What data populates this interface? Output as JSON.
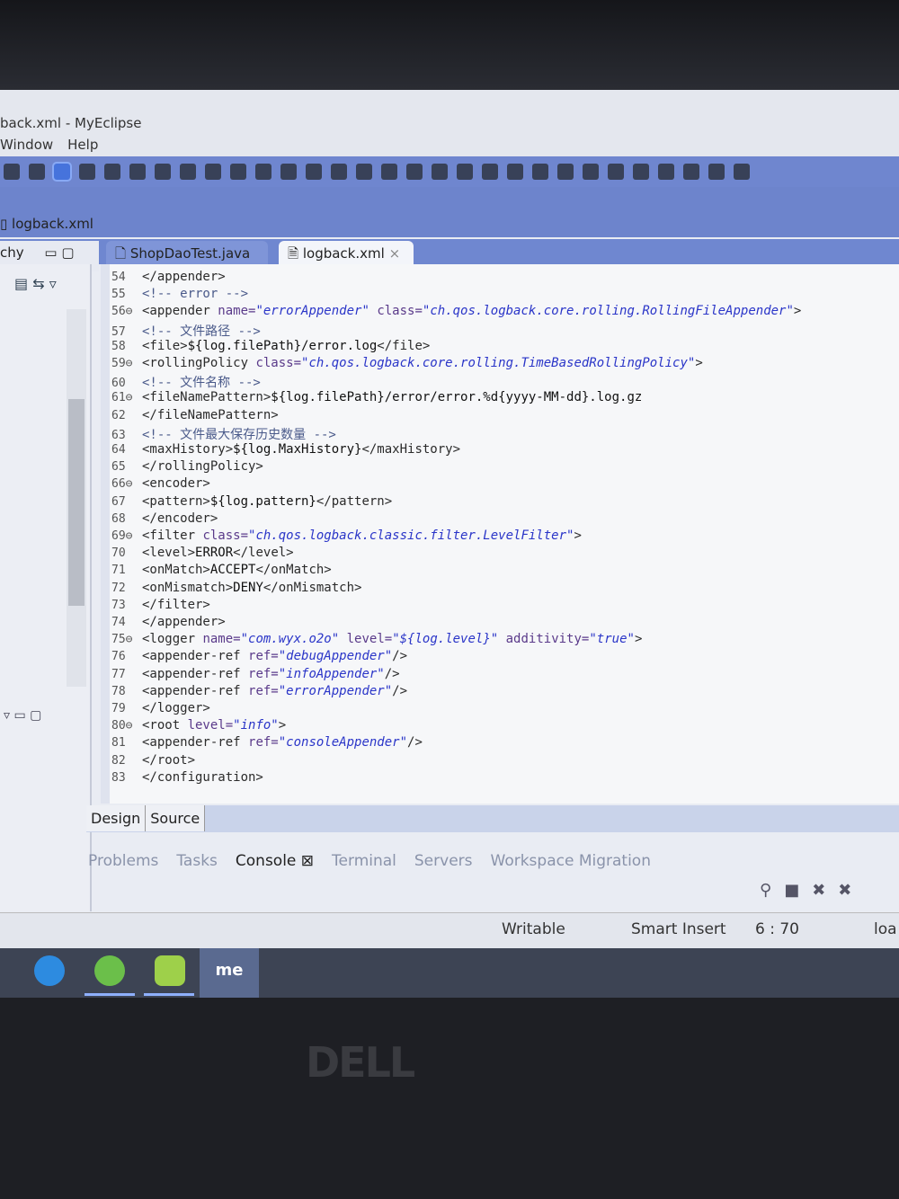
{
  "window": {
    "title": "back.xml - MyEclipse",
    "menu": [
      "Window",
      "Help"
    ]
  },
  "breadcrumb": "logback.xml",
  "left_panel": {
    "title": "chy"
  },
  "editor_tabs": [
    {
      "label": "ShopDaoTest.java",
      "active": false
    },
    {
      "label": "logback.xml",
      "active": true,
      "close": "×"
    }
  ],
  "code": [
    {
      "n": "54",
      "s": [
        [
          "tag",
          "</appender>"
        ]
      ]
    },
    {
      "n": "55",
      "s": [
        [
          "com",
          "<!-- error -->"
        ]
      ]
    },
    {
      "n": "56⊖",
      "s": [
        [
          "tag",
          "<appender "
        ],
        [
          "attr",
          "name="
        ],
        [
          "str",
          "\"errorAppender\""
        ],
        [
          "attr",
          " class="
        ],
        [
          "str",
          "\"ch.qos.logback.core.rolling.RollingFileAppender\""
        ],
        [
          "tag",
          ">"
        ]
      ]
    },
    {
      "n": "57",
      "s": [
        [
          "com",
          "<!-- 文件路径 -->"
        ]
      ]
    },
    {
      "n": "58",
      "s": [
        [
          "tag",
          "<file>"
        ],
        [
          "txt",
          "${log.filePath}/error.log"
        ],
        [
          "tag",
          "</file>"
        ]
      ]
    },
    {
      "n": "59⊖",
      "s": [
        [
          "tag",
          "<rollingPolicy "
        ],
        [
          "attr",
          "class="
        ],
        [
          "str",
          "\"ch.qos.logback.core.rolling.TimeBasedRollingPolicy\""
        ],
        [
          "tag",
          ">"
        ]
      ]
    },
    {
      "n": "60",
      "s": [
        [
          "com",
          "<!-- 文件名称 -->"
        ]
      ]
    },
    {
      "n": "61⊖",
      "s": [
        [
          "tag",
          "<fileNamePattern>"
        ],
        [
          "txt",
          "${log.filePath}/error/error.%d{yyyy-MM-dd}.log.gz"
        ]
      ]
    },
    {
      "n": "62",
      "s": [
        [
          "tag",
          "</fileNamePattern>"
        ]
      ]
    },
    {
      "n": "63",
      "s": [
        [
          "com",
          "<!-- 文件最大保存历史数量 -->"
        ]
      ]
    },
    {
      "n": "64",
      "s": [
        [
          "tag",
          "<maxHistory>"
        ],
        [
          "txt",
          "${log.MaxHistory}"
        ],
        [
          "tag",
          "</maxHistory>"
        ]
      ]
    },
    {
      "n": "65",
      "s": [
        [
          "tag",
          "</rollingPolicy>"
        ]
      ]
    },
    {
      "n": "66⊖",
      "s": [
        [
          "tag",
          "<encoder>"
        ]
      ]
    },
    {
      "n": "67",
      "s": [
        [
          "tag",
          "<pattern>"
        ],
        [
          "txt",
          "${log.pattern}"
        ],
        [
          "tag",
          "</pattern>"
        ]
      ]
    },
    {
      "n": "68",
      "s": [
        [
          "tag",
          "</encoder>"
        ]
      ]
    },
    {
      "n": "69⊖",
      "s": [
        [
          "tag",
          "<filter "
        ],
        [
          "attr",
          "class="
        ],
        [
          "str",
          "\"ch.qos.logback.classic.filter.LevelFilter\""
        ],
        [
          "tag",
          ">"
        ]
      ]
    },
    {
      "n": "70",
      "s": [
        [
          "tag",
          "<level>"
        ],
        [
          "txt",
          "ERROR"
        ],
        [
          "tag",
          "</level>"
        ]
      ]
    },
    {
      "n": "71",
      "s": [
        [
          "tag",
          "<onMatch>"
        ],
        [
          "txt",
          "ACCEPT"
        ],
        [
          "tag",
          "</onMatch>"
        ]
      ]
    },
    {
      "n": "72",
      "s": [
        [
          "tag",
          "<onMismatch>"
        ],
        [
          "txt",
          "DENY"
        ],
        [
          "tag",
          "</onMismatch>"
        ]
      ]
    },
    {
      "n": "73",
      "s": [
        [
          "tag",
          "</filter>"
        ]
      ]
    },
    {
      "n": "74",
      "s": [
        [
          "tag",
          "</appender>"
        ]
      ]
    },
    {
      "n": "75⊖",
      "s": [
        [
          "tag",
          "<logger "
        ],
        [
          "attr",
          "name="
        ],
        [
          "str",
          "\"com.wyx.o2o\""
        ],
        [
          "attr",
          " level="
        ],
        [
          "str",
          "\"${log.level}\""
        ],
        [
          "attr",
          " additivity="
        ],
        [
          "str",
          "\"true\""
        ],
        [
          "tag",
          ">"
        ]
      ]
    },
    {
      "n": "76",
      "s": [
        [
          "tag",
          "<appender-ref "
        ],
        [
          "attr",
          "ref="
        ],
        [
          "str",
          "\"debugAppender\""
        ],
        [
          "tag",
          "/>"
        ]
      ]
    },
    {
      "n": "77",
      "s": [
        [
          "tag",
          "<appender-ref "
        ],
        [
          "attr",
          "ref="
        ],
        [
          "str",
          "\"infoAppender\""
        ],
        [
          "tag",
          "/>"
        ]
      ]
    },
    {
      "n": "78",
      "s": [
        [
          "tag",
          "<appender-ref "
        ],
        [
          "attr",
          "ref="
        ],
        [
          "str",
          "\"errorAppender\""
        ],
        [
          "tag",
          "/>"
        ]
      ]
    },
    {
      "n": "79",
      "s": [
        [
          "tag",
          "</logger>"
        ]
      ]
    },
    {
      "n": "80⊖",
      "s": [
        [
          "tag",
          "<root "
        ],
        [
          "attr",
          "level="
        ],
        [
          "str",
          "\"info\""
        ],
        [
          "tag",
          ">"
        ]
      ]
    },
    {
      "n": "81",
      "s": [
        [
          "tag",
          "<appender-ref "
        ],
        [
          "attr",
          "ref="
        ],
        [
          "str",
          "\"consoleAppender\""
        ],
        [
          "tag",
          "/>"
        ]
      ]
    },
    {
      "n": "82",
      "s": [
        [
          "tag",
          "</root>"
        ]
      ]
    },
    {
      "n": "83",
      "s": [
        [
          "tag",
          "</configuration>"
        ]
      ]
    }
  ],
  "editor_mode_tabs": [
    "Design",
    "Source"
  ],
  "bottom_tabs": [
    {
      "label": "Problems"
    },
    {
      "label": "Tasks"
    },
    {
      "label": "Console ⊠",
      "active": true
    },
    {
      "label": "Terminal"
    },
    {
      "label": "Servers"
    },
    {
      "label": "Workspace Migration"
    }
  ],
  "status": {
    "writable": "Writable",
    "insert": "Smart Insert",
    "position": "6 : 70",
    "extra": "loa"
  },
  "taskbar": {
    "app_label": "me"
  },
  "bezel_logo": "DELL",
  "colors": {
    "toolbar": "#6f86cf",
    "string": "#2a35c8",
    "taskbar": "#3d4454"
  }
}
